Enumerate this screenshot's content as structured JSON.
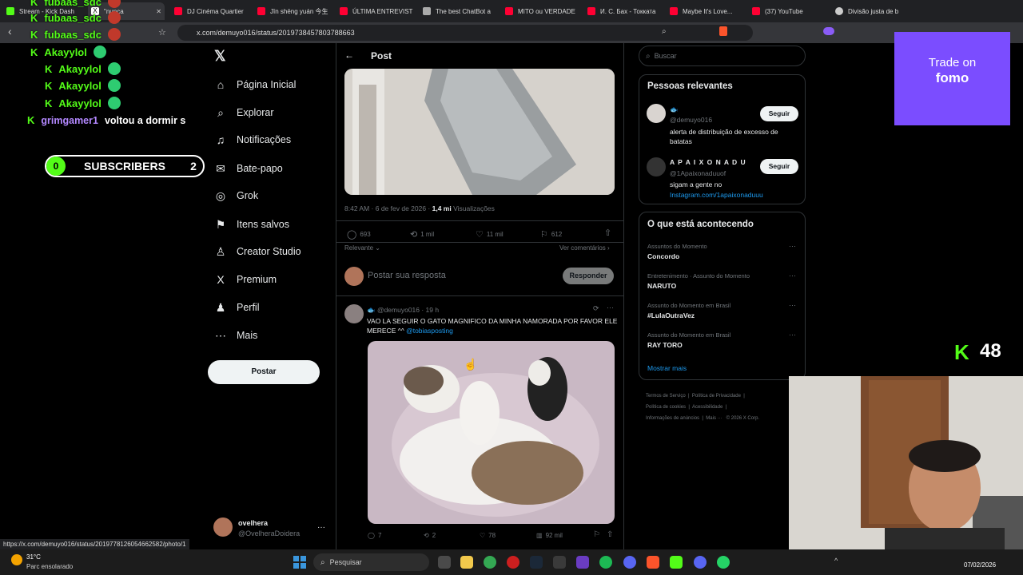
{
  "browser": {
    "tabs": [
      {
        "label": "Stream - Kick Dash",
        "color": "#53fc18"
      },
      {
        "label": "\"nunca",
        "color": "#444"
      },
      {
        "label": "DJ Cinéma Quartier",
        "color": "#ff0033"
      },
      {
        "label": "Jīn shēng yuán 今生",
        "color": "#ff0033"
      },
      {
        "label": "ÚLTIMA ENTREVIST",
        "color": "#ff0033"
      },
      {
        "label": "The best ChatBot a",
        "color": "#aaa"
      },
      {
        "label": "MITO ou VERDADE",
        "color": "#ff0033"
      },
      {
        "label": "И. С. Бах - Токката",
        "color": "#ff0033"
      },
      {
        "label": "Maybe It's Love... ",
        "color": "#ff0033"
      },
      {
        "label": "(37) YouTube",
        "color": "#ff0033"
      },
      {
        "label": "Divisão justa de b",
        "color": "#ccc"
      }
    ],
    "url": "x.com/demuyo016/status/2019738457803788663",
    "status_link": "https://x.com/demuyo016/status/2019778126054662582/photo/1"
  },
  "kick_chat": [
    {
      "user": "fubaas_sdc",
      "color": "#53fc18"
    },
    {
      "user": "fubaas_sdc",
      "color": "#53fc18"
    },
    {
      "user": "fubaas_sdc",
      "color": "#53fc18"
    },
    {
      "user": "Akayylol",
      "color": "#53fc18"
    },
    {
      "user": "Akayylol",
      "color": "#53fc18"
    },
    {
      "user": "Akayylol",
      "color": "#53fc18"
    },
    {
      "user": "Akayylol",
      "color": "#53fc18"
    }
  ],
  "kick_msg": {
    "user": "grimgamer1",
    "text": "voltou a dormir s"
  },
  "subs": {
    "left": "0",
    "label": "SUBSCRIBERS",
    "right": "2"
  },
  "trade_ad": {
    "line1": "Trade on",
    "line2": "fomo"
  },
  "viewers": "48",
  "nav": {
    "items": [
      {
        "label": "Página Inicial",
        "icon": "⌂"
      },
      {
        "label": "Explorar",
        "icon": "⌕"
      },
      {
        "label": "Notificações",
        "icon": "🔔"
      },
      {
        "label": "Bate-papo",
        "icon": "✉"
      },
      {
        "label": "Grok",
        "icon": "◎"
      },
      {
        "label": "Itens salvos",
        "icon": "⚑"
      },
      {
        "label": "Creator Studio",
        "icon": "♙"
      },
      {
        "label": "Premium",
        "icon": "X"
      },
      {
        "label": "Perfil",
        "icon": "♟"
      },
      {
        "label": "Mais",
        "icon": "⋯"
      }
    ],
    "post_button": "Postar",
    "account_name": "ovelhera",
    "account_handle": "@OvelheraDoidera"
  },
  "post": {
    "header": "Post",
    "meta_time": "8:42 AM · 6 de fev de 2026 · ",
    "meta_views": "1,4 mi",
    "meta_views_label": " Visualizações",
    "stats": {
      "replies": "693",
      "reposts": "1 mil",
      "likes": "11 mil",
      "bookmarks": "612"
    },
    "sort": "Relevante",
    "see_comments": "Ver comentários",
    "reply_placeholder": "Postar sua resposta",
    "reply_button": "Responder"
  },
  "reply": {
    "handle": "@demuyo016 · 19 h",
    "text": "VAO LA SEGUIR O GATO MAGNIFICO DA MINHA NAMORADA POR FAVOR ELE MERECE ^^ ",
    "mention": "@tobiasposting",
    "stats": {
      "replies": "7",
      "reposts": "2",
      "likes": "78",
      "views": "92 mil"
    }
  },
  "search": {
    "placeholder": "Buscar"
  },
  "relevant": {
    "title": "Pessoas relevantes",
    "people": [
      {
        "name": "🐟",
        "handle": "@demuyo016",
        "bio": "alerta de distribuição de excesso de batatas",
        "link": "",
        "follow": "Seguir"
      },
      {
        "name": "A P A I X O N A D U",
        "handle": "@1Apaixonaduuof",
        "bio": "sigam a gente no",
        "link": "Instagram.com/1apaixonaduuu",
        "follow": "Seguir"
      }
    ]
  },
  "trends": {
    "title": "O que está acontecendo",
    "items": [
      {
        "context": "Assuntos do Momento",
        "name": "Concordo"
      },
      {
        "context": "Entretenimento · Assunto do Momento",
        "name": "NARUTO"
      },
      {
        "context": "Assunto do Momento em Brasil",
        "name": "#LulaOutraVez"
      },
      {
        "context": "Assunto do Momento em Brasil",
        "name": "RAY TORO"
      }
    ],
    "show_more": "Mostrar mais"
  },
  "footer_links": [
    "Termos de Serviço",
    "Política de Privacidade",
    "Política de cookies",
    "Acessibilidade",
    "Informações de anúncios",
    "Mais ···",
    "© 2026 X Corp."
  ],
  "taskbar": {
    "weather_temp": "31°C",
    "weather_desc": "Parc ensolarado",
    "search": "Pesquisar",
    "date": "07/02/2026"
  }
}
